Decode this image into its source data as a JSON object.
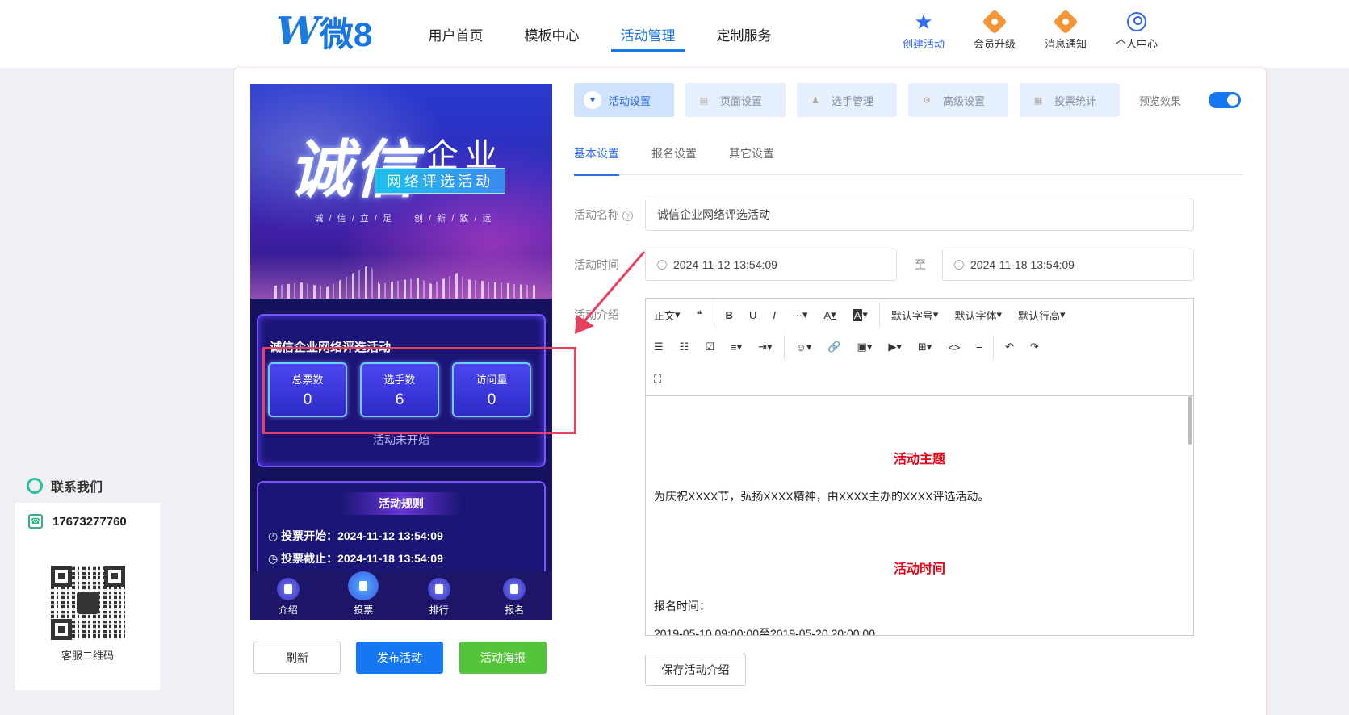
{
  "logo": {
    "mark": "W",
    "text": "微8"
  },
  "nav": {
    "items": [
      {
        "label": "用户首页"
      },
      {
        "label": "模板中心"
      },
      {
        "label": "活动管理"
      },
      {
        "label": "定制服务"
      }
    ]
  },
  "tools": [
    {
      "label": "创建活动",
      "icon": "star-icon"
    },
    {
      "label": "会员升级",
      "icon": "vip-badge-icon"
    },
    {
      "label": "消息通知",
      "icon": "bell-badge-icon"
    },
    {
      "label": "个人中心",
      "icon": "user-icon"
    }
  ],
  "contact": {
    "title": "联系我们",
    "phone": "17673277760",
    "qr_label": "客服二维码"
  },
  "preview": {
    "banner": {
      "title_big": "诚信",
      "title_small": "企业",
      "subtitle": "网络评选活动",
      "slogan": "诚 / 信 / 立 / 足　　创 / 新 / 致 / 远"
    },
    "activity_title": "诚信企业网络评选活动",
    "stats": [
      {
        "label": "总票数",
        "value": "0"
      },
      {
        "label": "选手数",
        "value": "6"
      },
      {
        "label": "访问量",
        "value": "0"
      }
    ],
    "status": "活动未开始",
    "rules_title": "活动规则",
    "rules": [
      "投票开始：2024-11-12 13:54:09",
      "投票截止：2024-11-18 13:54:09"
    ],
    "tabs": [
      {
        "label": "介绍"
      },
      {
        "label": "投票"
      },
      {
        "label": "排行"
      },
      {
        "label": "报名"
      }
    ]
  },
  "actions": {
    "refresh": "刷新",
    "publish": "发布活动",
    "poster": "活动海报"
  },
  "top_tabs": [
    {
      "label": "活动设置",
      "icon": "heart-icon"
    },
    {
      "label": "页面设置",
      "icon": "page-icon"
    },
    {
      "label": "选手管理",
      "icon": "player-icon"
    },
    {
      "label": "高级设置",
      "icon": "advanced-icon"
    },
    {
      "label": "投票统计",
      "icon": "stats-icon"
    }
  ],
  "preview_toggle": {
    "label": "预览效果",
    "on": true
  },
  "sub_tabs": [
    {
      "label": "基本设置"
    },
    {
      "label": "报名设置"
    },
    {
      "label": "其它设置"
    }
  ],
  "form": {
    "name_label": "活动名称",
    "name_value": "诚信企业网络评选活动",
    "time_label": "活动时间",
    "start": "2024-11-12 13:54:09",
    "to": "至",
    "end": "2024-11-18 13:54:09",
    "intro_label": "活动介绍"
  },
  "toolbar": {
    "row1": [
      "正文",
      "❝",
      "B",
      "U",
      "I",
      "···",
      "A",
      "A",
      "默认字号",
      "默认字体",
      "默认行高"
    ],
    "row2": [
      "☰",
      "☷",
      "☑",
      "≡",
      "⇥",
      "☺",
      "🔗",
      "▣",
      "▶",
      "⊞",
      "<>",
      "⎯",
      "↶",
      "↷"
    ],
    "row3": [
      "⛶"
    ]
  },
  "editor": {
    "h1": "活动主题",
    "p1": "为庆祝XXXX节，弘扬XXXX精神，由XXXX主办的XXXX评选活动。",
    "h2": "活动时间",
    "p2": "报名时间：",
    "p3": "2019-05-10 09:00:00至2019-05-20 20:00:00"
  },
  "save_label": "保存活动介绍",
  "accent": "#1677f5",
  "annotation_color": "#e9405d"
}
